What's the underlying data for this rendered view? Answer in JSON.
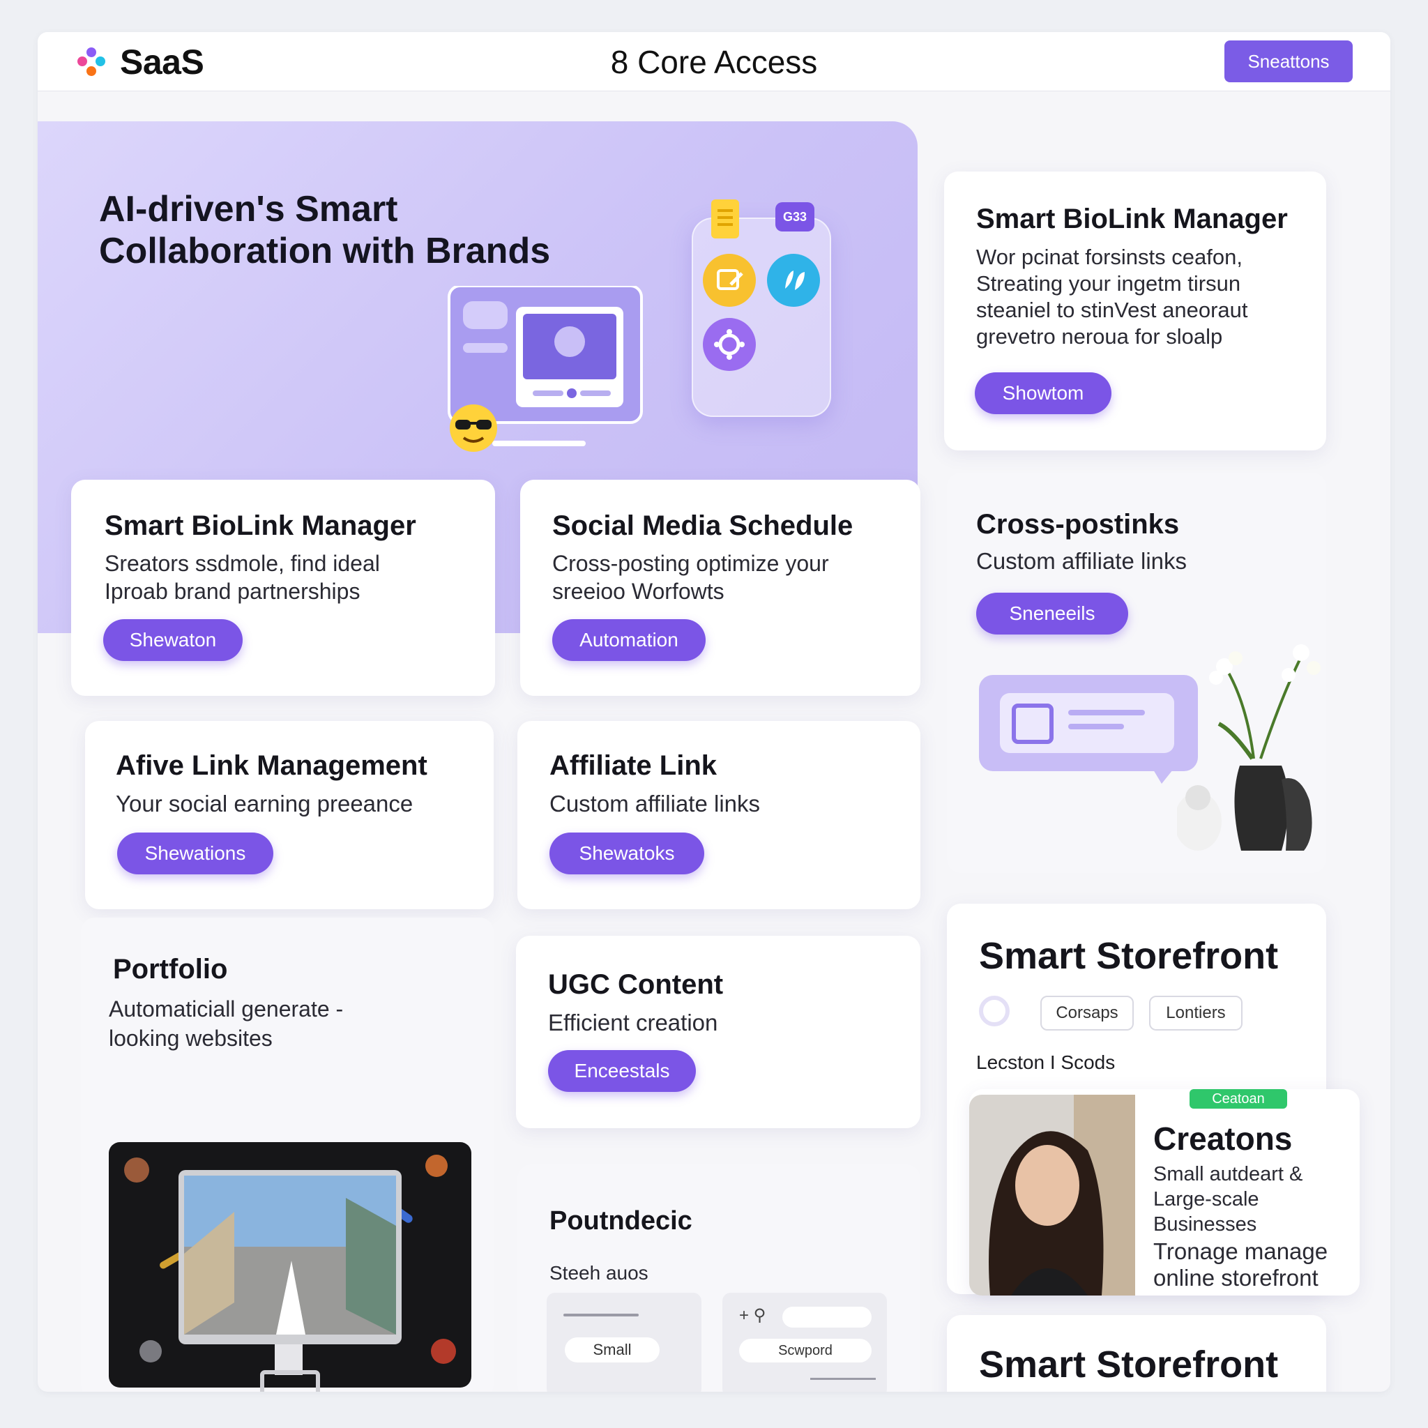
{
  "header": {
    "brand": "SaaS",
    "title": "8 Core Access",
    "action_button": "Sneattons"
  },
  "hero": {
    "title": "AI-driven's Smart Collaboration with Brands",
    "badge": "G33"
  },
  "cards": {
    "biolink_top": {
      "title": "Smart BioLink Manager",
      "text": "Wor pcinat forsinsts ceafon, Streating your ingetm tirsun steaniel to stinVest aneoraut grevetro neroua for sloalp",
      "button": "Showtom"
    },
    "biolink": {
      "title": "Smart BioLink Manager",
      "text": "Sreators ssdmole, find ideal Iproab brand partnerships",
      "button": "Shewaton"
    },
    "social_schedule": {
      "title": "Social Media Schedule",
      "text": "Cross-posting optimize your sreeioo Worfowts",
      "button": "Automation"
    },
    "crosspost": {
      "title": "Cross-postinks",
      "text": "Custom affiliate links",
      "button": "Sneneeils"
    },
    "afive_link": {
      "title": "Afive Link Management",
      "text": "Your social earning preeance",
      "button": "Shewations"
    },
    "affiliate": {
      "title": "Affiliate Link",
      "text": "Custom affiliate links",
      "button": "Shewatoks"
    },
    "portfolio": {
      "title": "Portfolio",
      "text": "Automaticiall generate -looking websites"
    },
    "ugc": {
      "title": "UGC Content",
      "text": "Efficient creation",
      "button": "Enceestals"
    },
    "poutndecic": {
      "title": "Poutndecic",
      "subtitle": "Steeh auos",
      "field_small": "Small",
      "field_swd": "Scwpord"
    },
    "storefront": {
      "title": "Smart Storefront",
      "chips": [
        "Corsaps",
        "Lontiers"
      ],
      "section_label": "Lecston I Scods",
      "badge": "Ceatoan",
      "creators_title": "Creatons",
      "creators_text": "Small autdeart & Large-scale Businesses",
      "creators_subtext": "Tronage manage online storefront"
    },
    "storefront_bottom": {
      "title": "Smart Storefront"
    }
  },
  "colors": {
    "accent": "#7b55e6",
    "hero_bg": "#cdc5f7",
    "badge_green": "#2fc76b"
  }
}
